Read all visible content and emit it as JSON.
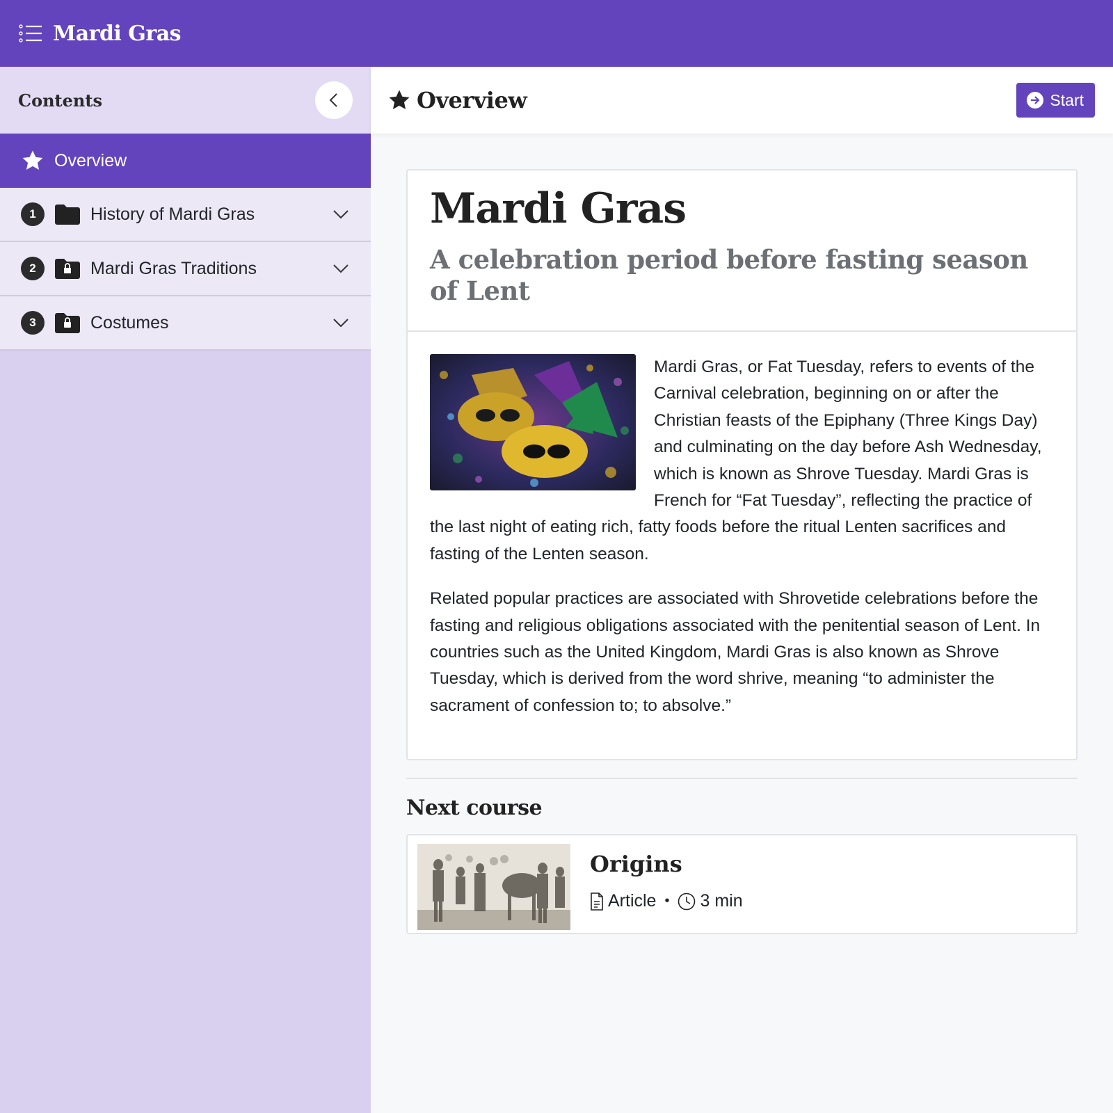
{
  "app": {
    "title": "Mardi Gras",
    "accent_color": "#6344bc",
    "sidebar_bg": "#d9d0ef"
  },
  "sidebar": {
    "title": "Contents",
    "collapse_icon": "chevron-left-icon",
    "items": [
      {
        "label": "Overview",
        "icon": "star-icon",
        "active": true
      },
      {
        "number": "1",
        "label": "History of Mardi Gras",
        "icon": "folder-icon",
        "locked": false
      },
      {
        "number": "2",
        "label": "Mardi Gras Traditions",
        "icon": "folder-lock-icon",
        "locked": true
      },
      {
        "number": "3",
        "label": "Costumes",
        "icon": "folder-lock-icon",
        "locked": true
      }
    ]
  },
  "main": {
    "header_title": "Overview",
    "start_label": "Start",
    "card": {
      "title": "Mardi Gras",
      "subtitle": "A celebration period before fasting season of Lent",
      "image": "mardi-gras-masks-image",
      "paragraphs": [
        "Mardi Gras, or Fat Tuesday, refers to events of the Carnival celebration, beginning on or after the Christian feasts of the Epiphany (Three Kings Day) and culminating on the day before Ash Wednesday, which is known as Shrove Tuesday. Mardi Gras is French for “Fat Tuesday”, reflecting the practice of the last night of eating rich, fatty foods before the ritual Lenten sacrifices and fasting of the Lenten season.",
        "Related popular practices are associated with Shrovetide celebrations before the fasting and religious obligations associated with the penitential season of Lent. In countries such as the United Kingdom, Mardi Gras is also known as Shrove Tuesday, which is derived from the word shrive, meaning “to administer the sacrament of confession to; to absolve.”"
      ]
    },
    "next_course": {
      "heading": "Next course",
      "name": "Origins",
      "type": "Article",
      "separator": "•",
      "duration": "3 min",
      "image": "historical-engraving-image"
    }
  }
}
